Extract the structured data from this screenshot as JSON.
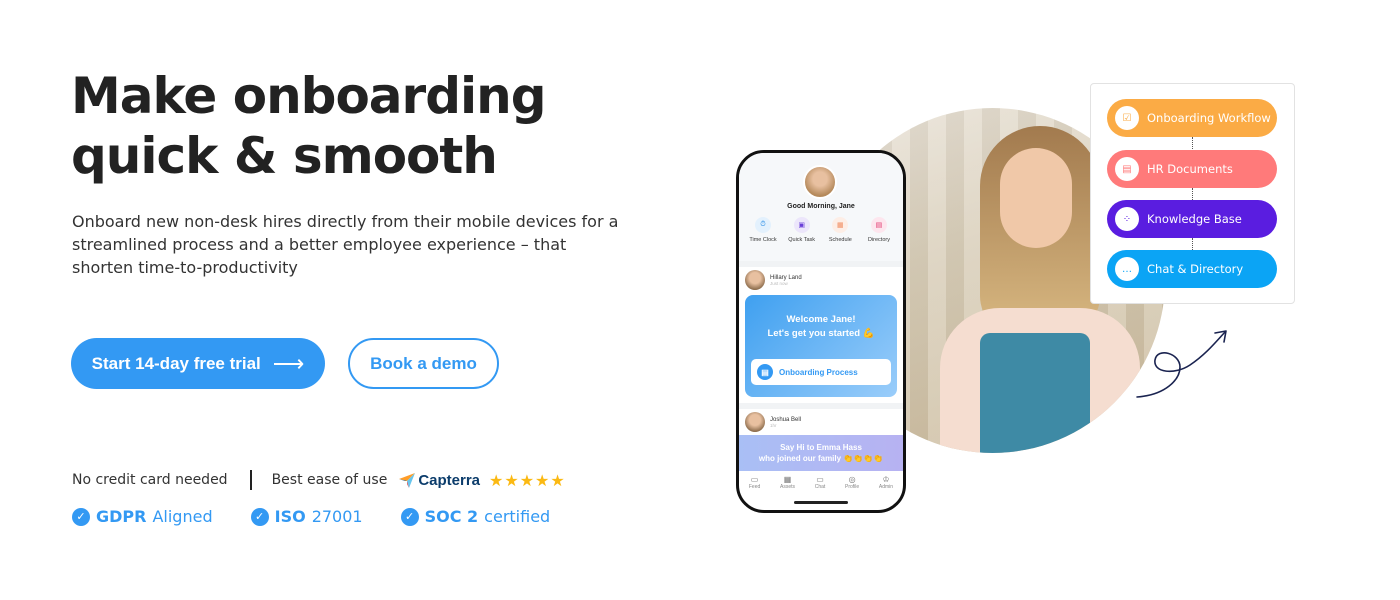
{
  "hero": {
    "title_line1": "Make onboarding",
    "title_line2": "quick & smooth",
    "description": "Onboard new non-desk hires directly from their mobile devices for a streamlined process and a better employee experience – that shorten time-to-productivity"
  },
  "cta": {
    "primary_label": "Start 14-day free trial",
    "primary_arrow": "⟶",
    "secondary_label": "Book a demo"
  },
  "trust": {
    "no_card": "No credit card needed",
    "ease": "Best ease of use",
    "capterra_name": "Capterra",
    "rating_stars": 5,
    "stars_text": "★★★★★"
  },
  "certifications": [
    {
      "bold": "GDPR",
      "rest": "Aligned",
      "check": "✓"
    },
    {
      "bold": "ISO",
      "rest": "27001",
      "check": "✓"
    },
    {
      "bold": "SOC 2",
      "rest": "certified",
      "check": "✓"
    }
  ],
  "phone": {
    "greeting": "Good Morning, Jane",
    "quick_actions": [
      {
        "label": "Time Clock",
        "icon": "⏱",
        "bg": "#e3f1fd",
        "color": "#1e88e5"
      },
      {
        "label": "Quick Task",
        "icon": "▣",
        "bg": "#ece6fb",
        "color": "#6a3fd8"
      },
      {
        "label": "Schedule",
        "icon": "▦",
        "bg": "#fdeee6",
        "color": "#f08a5d"
      },
      {
        "label": "Directory",
        "icon": "▤",
        "bg": "#fde6ee",
        "color": "#e0336b"
      }
    ],
    "post1": {
      "name": "Hillary Land",
      "time": "Just now"
    },
    "welcome_text_line1": "Welcome Jane!",
    "welcome_text_line2": "Let's get you started 💪",
    "onboarding_button": "Onboarding Process",
    "post2": {
      "name": "Joshua Bell",
      "time": "1hr"
    },
    "banner_line1": "Say Hi to Emma Hass",
    "banner_line2": "who joined our family 👏👏👏👏",
    "nav": [
      {
        "label": "Feed",
        "icon": "▭"
      },
      {
        "label": "Assets",
        "icon": "▦"
      },
      {
        "label": "Chat",
        "icon": "▭"
      },
      {
        "label": "Profile",
        "icon": "◎"
      },
      {
        "label": "Admin",
        "icon": "♔"
      }
    ]
  },
  "features": [
    {
      "label": "Onboarding Workflow",
      "color": "#fbab45",
      "icon": "☑",
      "icon_color": "#fbab45"
    },
    {
      "label": "HR Documents",
      "color": "#ff7a7a",
      "icon": "▤",
      "icon_color": "#ff7a7a"
    },
    {
      "label": "Knowledge Base",
      "color": "#5a1de0",
      "icon": "⁘",
      "icon_color": "#5a1de0"
    },
    {
      "label": "Chat & Directory",
      "color": "#0ba4f5",
      "icon": "…",
      "icon_color": "#0ba4f5"
    }
  ]
}
